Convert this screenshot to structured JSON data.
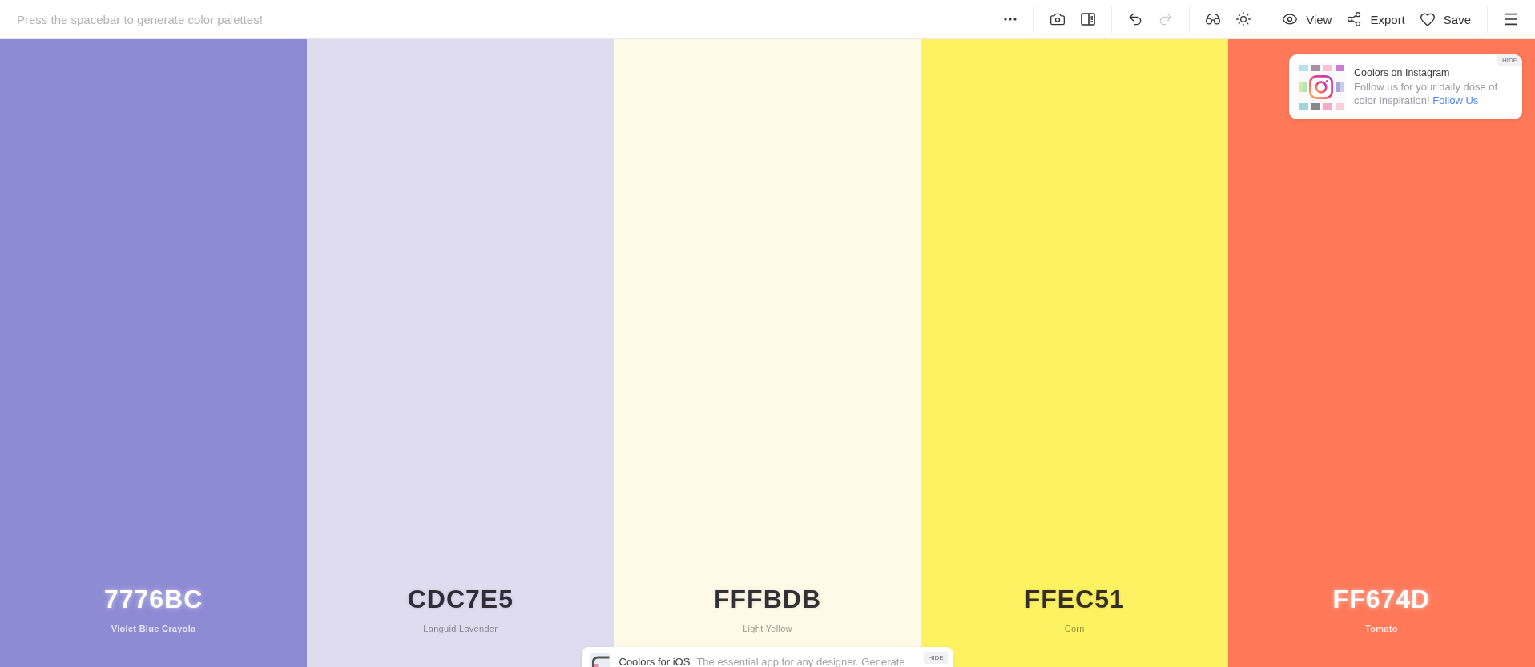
{
  "toolbar": {
    "hint": "Press the spacebar to generate color palettes!",
    "undo": {
      "disabled": false
    },
    "redo": {
      "disabled": true
    },
    "actions": [
      {
        "label": "View"
      },
      {
        "label": "Export"
      },
      {
        "label": "Save"
      }
    ]
  },
  "palette": [
    {
      "hex": "7776BC",
      "name": "Violet Blue Crayola",
      "color": "#8e8bd5",
      "light_text": true
    },
    {
      "hex": "CDC7E5",
      "name": "Languid Lavender",
      "color": "#e0dcf0",
      "light_text": false
    },
    {
      "hex": "FFFBDB",
      "name": "Light Yellow",
      "color": "#fefae7",
      "light_text": false
    },
    {
      "hex": "FFEC51",
      "name": "Corn",
      "color": "#fff262",
      "light_text": false
    },
    {
      "hex": "FF674D",
      "name": "Tomato",
      "color": "#ff7858",
      "light_text": true
    }
  ],
  "instagram_card": {
    "title": "Coolors on Instagram",
    "text": "Follow us for your daily dose of color inspiration!",
    "link": "Follow Us",
    "hide": "HIDE"
  },
  "ios_card": {
    "title": "Coolors for iOS",
    "text": "The essential app for any designer. Generate",
    "hide": "HIDE"
  }
}
